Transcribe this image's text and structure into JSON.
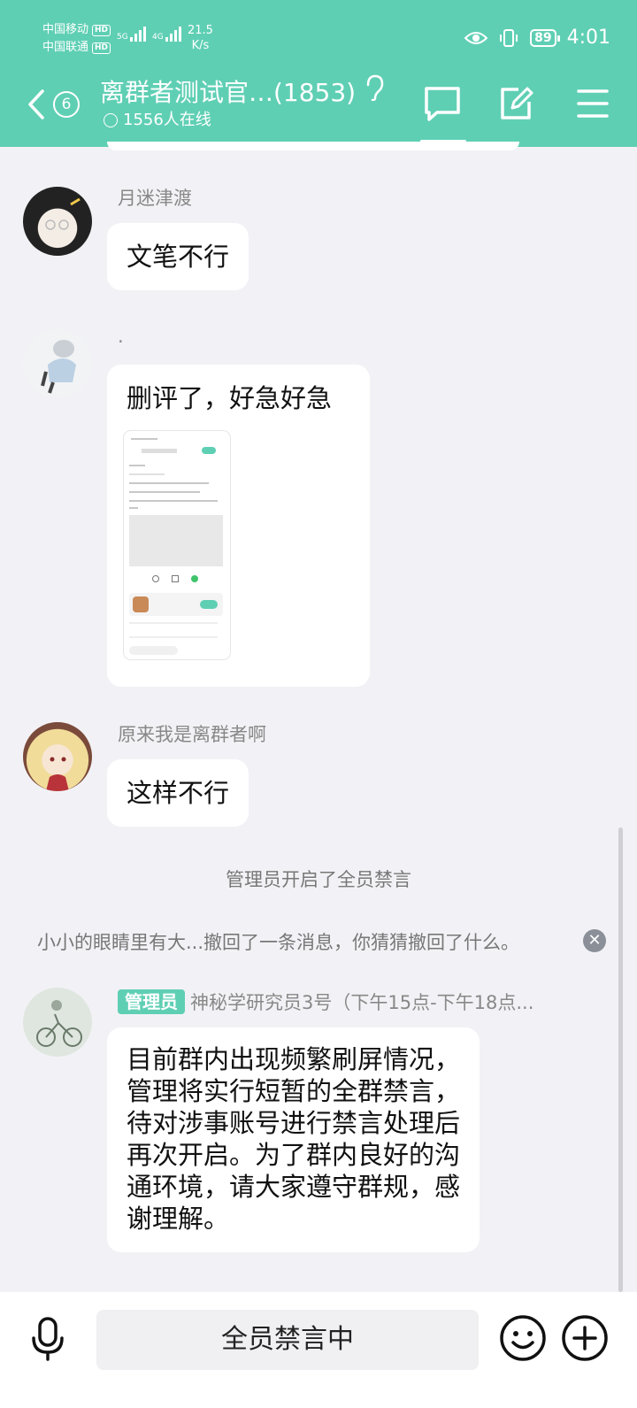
{
  "status_bar": {
    "carrier1": "中国移动",
    "carrier2": "中国联通",
    "hd": "HD",
    "sig1": "5G",
    "sig2": "4G",
    "speed_value": "21.5",
    "speed_unit": "K/s",
    "battery": "89",
    "time": "4:01"
  },
  "header": {
    "badge_count": "6",
    "title": "离群者测试官…(1853)",
    "online": "1556人在线"
  },
  "messages": [
    {
      "nick": "月迷津渡",
      "text": "文笔不行"
    },
    {
      "nick": ".",
      "text": "删评了，好急好急"
    },
    {
      "nick": "原来我是离群者啊",
      "text": "这样不行"
    }
  ],
  "system_notice": "管理员开启了全员禁言",
  "recall_notice": "小小的眼睛里有大...撤回了一条消息，你猜猜撤回了什么。",
  "admin_message": {
    "tag": "管理员",
    "nick": "神秘学研究员3号（下午15点-下午18点...",
    "lines": [
      "目前群内出现频繁刷屏情况，",
      "管理将实行短暂的全群禁言，",
      "待对涉事账号进行禁言处理后",
      "再次开启。为了群内良好的沟",
      "通环境，请大家遵守群规，感",
      "谢理解。"
    ]
  },
  "bottom": {
    "input_text": "全员禁言中"
  },
  "colors": {
    "accent": "#5fcfb4",
    "background": "#f2f2f6"
  },
  "icons": [
    "back-icon",
    "ear-icon",
    "chat-icon",
    "edit-icon",
    "menu-icon",
    "mic-icon",
    "emoji-icon",
    "plus-icon",
    "close-icon"
  ]
}
